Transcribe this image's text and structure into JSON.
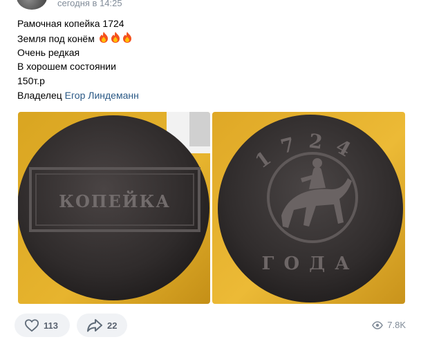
{
  "post": {
    "timestamp": "сегодня в 14:25",
    "lines": [
      "Рамочная копейка 1724",
      "Земля под конём",
      "Очень редкая",
      "В хорошем состоянии",
      "150т.р"
    ],
    "owner_prefix": "Владелец",
    "owner_name": "Егор Линдеманн",
    "emoji": "🔥🔥🔥"
  },
  "photos": {
    "obverse_legend": "КОПЕЙКА",
    "reverse_year": "1724",
    "reverse_word": "ГОДА"
  },
  "actions": {
    "likes": "113",
    "shares": "22",
    "views": "7.8K"
  },
  "colors": {
    "link": "#2a5885",
    "meta": "#818c99",
    "button_bg": "#f0f2f5"
  },
  "icons": [
    "heart-icon",
    "share-arrow-icon",
    "eye-icon",
    "fire-icon"
  ]
}
